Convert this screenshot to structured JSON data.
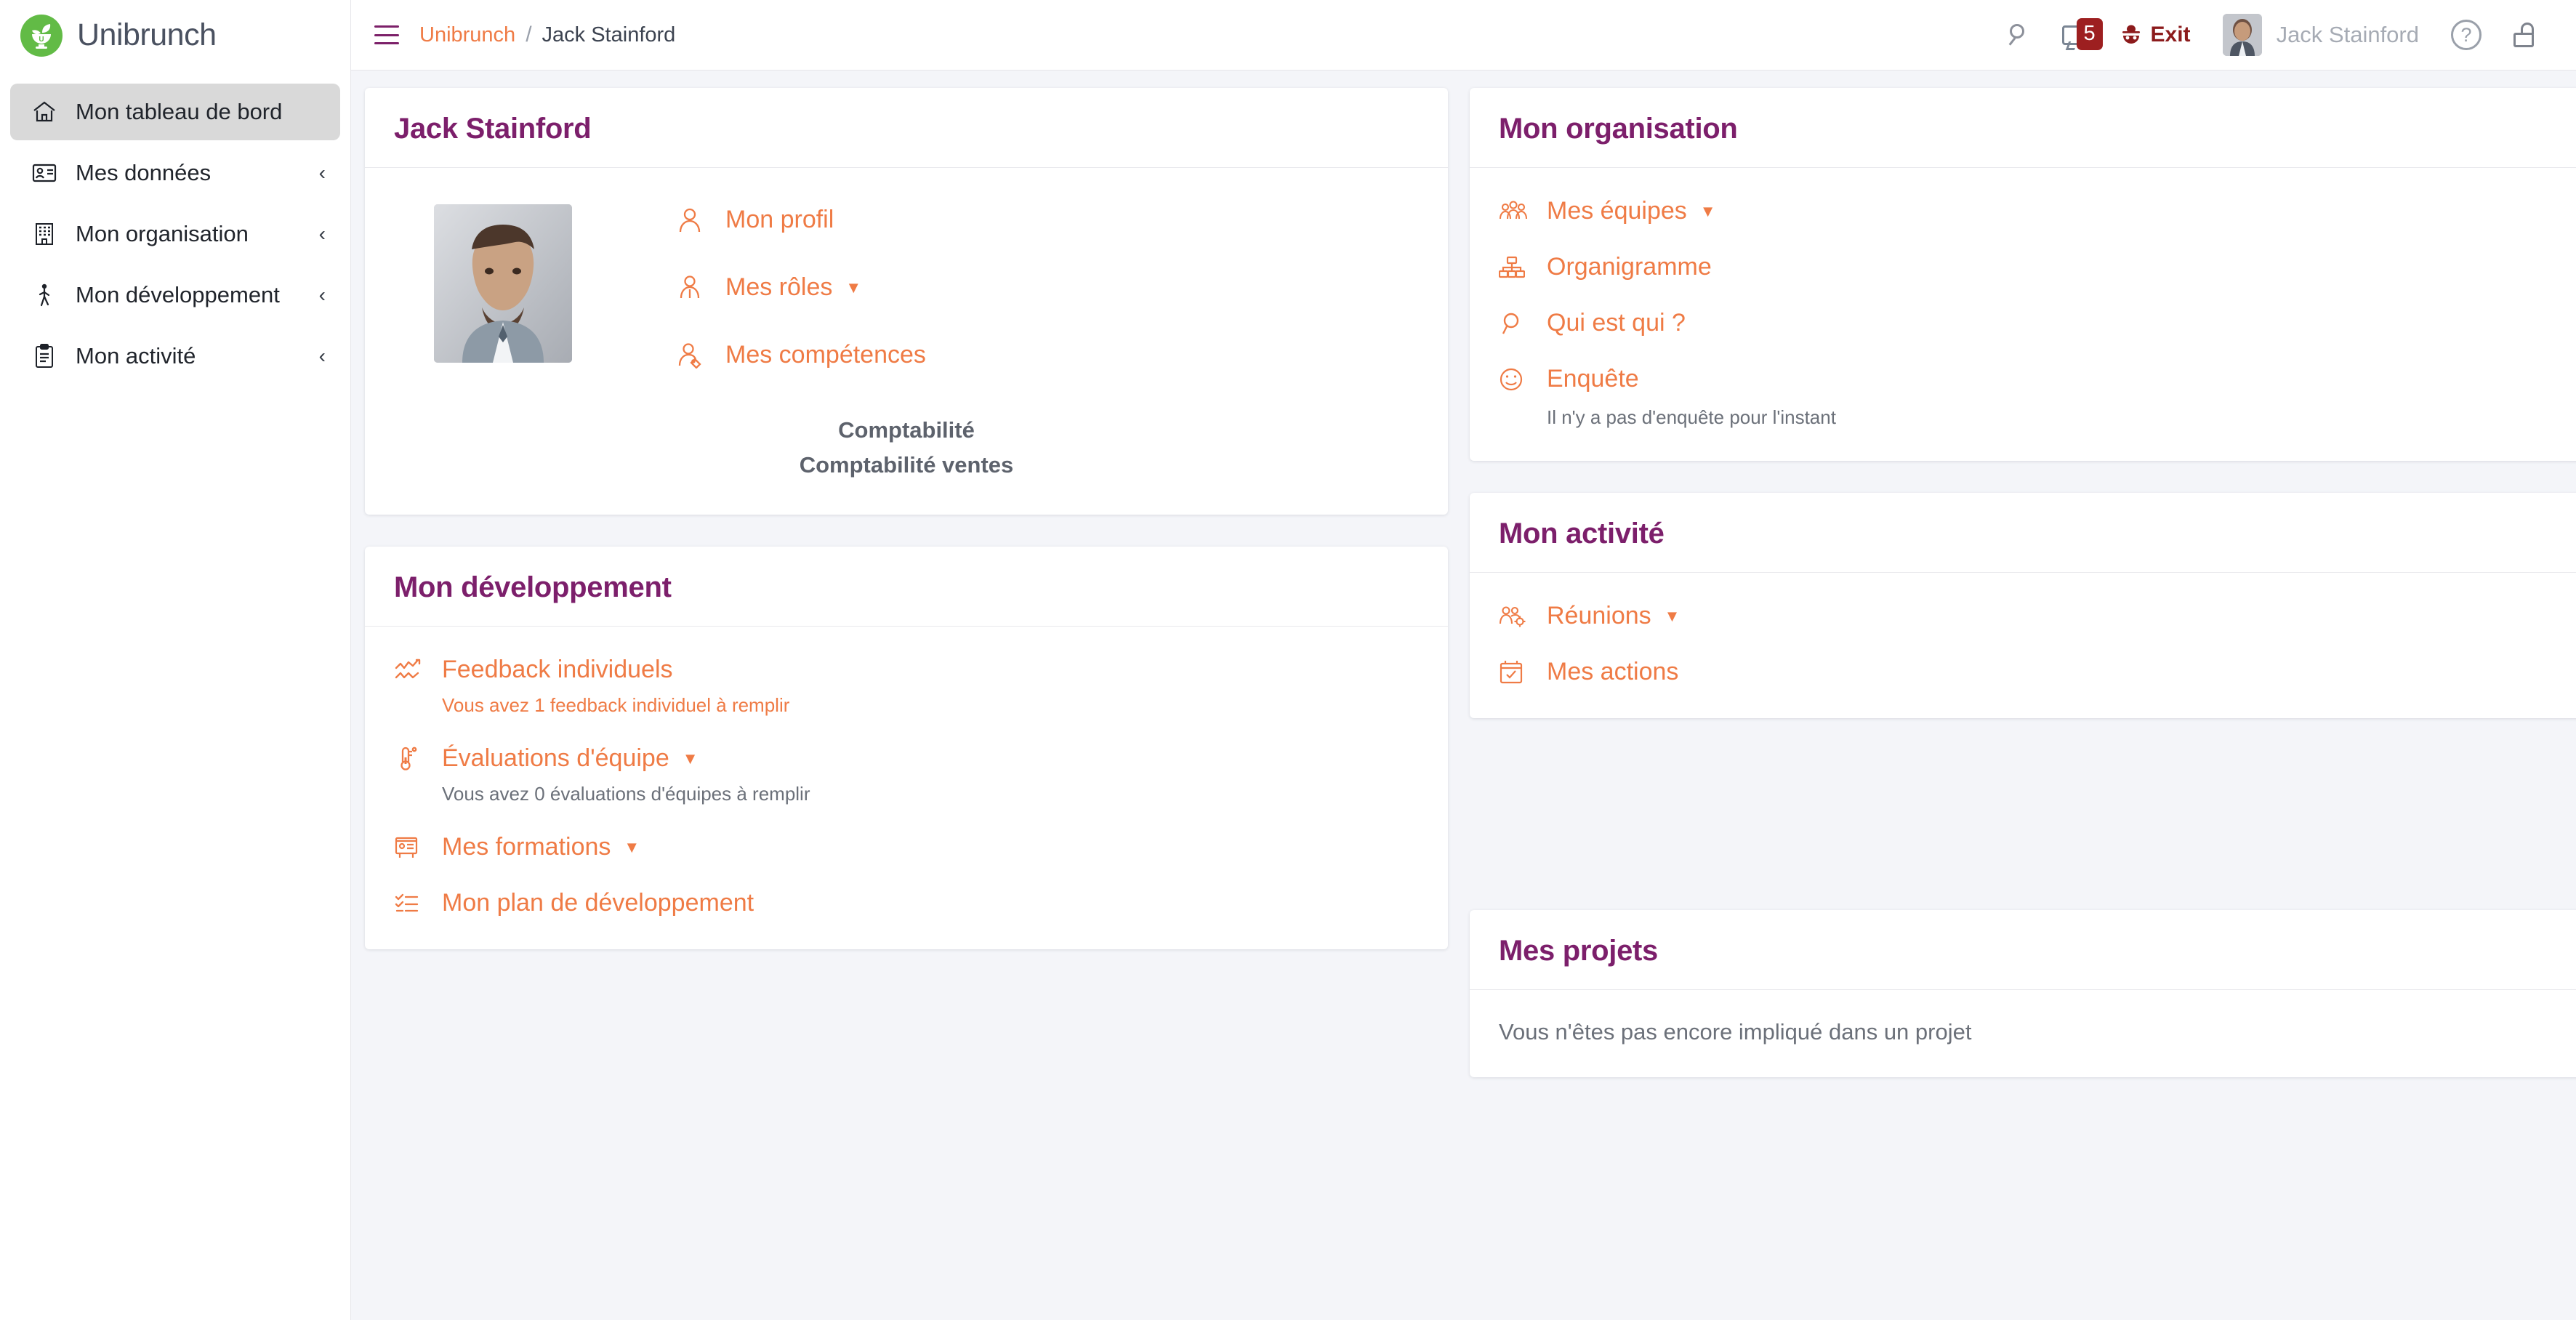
{
  "brand": {
    "name": "Unibrunch",
    "logo_icon": "bowl-leaves-logo"
  },
  "topbar": {
    "menu_icon": "hamburger-icon",
    "breadcrumb": {
      "root": "Unibrunch",
      "separator": "/",
      "current": "Jack Stainford"
    },
    "search_icon": "search-icon",
    "messages": {
      "icon": "message-bubble-icon",
      "count": "5"
    },
    "exit": {
      "icon": "spy-incognito-icon",
      "label": "Exit"
    },
    "user": {
      "avatar_icon": "user-avatar",
      "name": "Jack Stainford"
    },
    "help": {
      "icon": "question-mark-icon",
      "label": "?"
    },
    "lock": {
      "icon": "unlock-padlock-icon"
    }
  },
  "sidebar": {
    "items": [
      {
        "label": "Mon tableau de bord",
        "icon": "home-icon",
        "active": true,
        "chevron": ""
      },
      {
        "label": "Mes données",
        "icon": "id-card-icon",
        "active": false,
        "chevron": "‹"
      },
      {
        "label": "Mon organisation",
        "icon": "building-icon",
        "active": false,
        "chevron": "‹"
      },
      {
        "label": "Mon développement",
        "icon": "walking-person-icon",
        "active": false,
        "chevron": "‹"
      },
      {
        "label": "Mon activité",
        "icon": "clipboard-icon",
        "active": false,
        "chevron": "‹"
      }
    ]
  },
  "cards": {
    "profile": {
      "title": "Jack Stainford",
      "avatar_icon": "profile-photo",
      "links": [
        {
          "label": "Mon profil",
          "icon": "person-icon",
          "caret": false
        },
        {
          "label": "Mes rôles",
          "icon": "person-tie-icon",
          "caret": true
        },
        {
          "label": "Mes compétences",
          "icon": "person-tag-icon",
          "caret": false
        }
      ],
      "roles": [
        "Comptabilité",
        "Comptabilité ventes"
      ]
    },
    "organisation": {
      "title": "Mon organisation",
      "links": [
        {
          "label": "Mes équipes",
          "icon": "group-people-icon",
          "caret": true
        },
        {
          "label": "Organigramme",
          "icon": "org-chart-icon",
          "caret": false
        },
        {
          "label": "Qui est qui ?",
          "icon": "search-icon",
          "caret": false
        },
        {
          "label": "Enquête",
          "icon": "smiley-face-icon",
          "caret": false
        }
      ],
      "survey_note": "Il n'y a pas d'enquête pour l'instant"
    },
    "development": {
      "title": "Mon développement",
      "links": [
        {
          "label": "Feedback individuels",
          "icon": "trend-zigzag-icon",
          "caret": false,
          "note": "Vous avez 1 feedback individuel à remplir",
          "note_color": "orange"
        },
        {
          "label": "Évaluations d'équipe",
          "icon": "thermometer-icon",
          "caret": true,
          "note": "Vous avez 0 évaluations d'équipes à remplir",
          "note_color": "gray"
        },
        {
          "label": "Mes formations",
          "icon": "training-board-icon",
          "caret": true,
          "note": ""
        },
        {
          "label": "Mon plan de développement",
          "icon": "checklist-icon",
          "caret": false,
          "note": ""
        }
      ]
    },
    "activity": {
      "title": "Mon activité",
      "links": [
        {
          "label": "Réunions",
          "icon": "people-gear-icon",
          "caret": true
        },
        {
          "label": "Mes actions",
          "icon": "calendar-check-icon",
          "caret": false
        }
      ]
    },
    "projects": {
      "title": "Mes projets",
      "empty_message": "Vous n'êtes pas encore impliqué dans un projet"
    }
  },
  "colors": {
    "brand_green": "#62bb46",
    "accent_orange": "#ef7b45",
    "title_purple": "#7c1f6b",
    "exit_red": "#8c1b1c",
    "badge_red": "#9d1f20",
    "page_bg": "#f4f5f9"
  }
}
